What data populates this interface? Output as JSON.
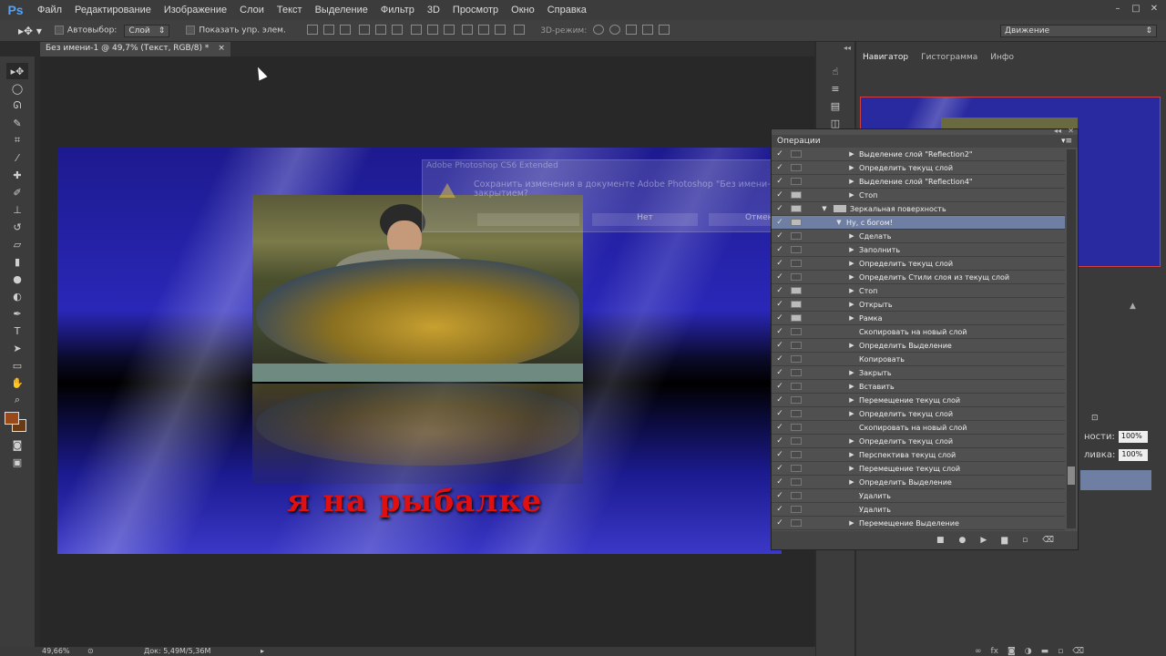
{
  "app": {
    "logo": "Ps"
  },
  "menu": [
    "Файл",
    "Редактирование",
    "Изображение",
    "Слои",
    "Текст",
    "Выделение",
    "Фильтр",
    "3D",
    "Просмотр",
    "Окно",
    "Справка"
  ],
  "options": {
    "autoselect_label": "Автовыбор:",
    "autoselect_value": "Слой",
    "show_controls_label": "Показать упр. элем.",
    "mode3d_label": "3D-режим:",
    "workspace_value": "Движение"
  },
  "document": {
    "tab_title": "Без имени-1 @ 49,7% (Текст, RGB/8) *",
    "close_glyph": "×",
    "artwork_text": "я на рыбалке"
  },
  "dialog": {
    "title": "Adobe Photoshop CS6 Extended",
    "message": "Сохранить изменения в документе Adobe Photoshop \"Без имени-1\" перед закрытием?",
    "no_button": "Нет",
    "cancel_button": "Отмена"
  },
  "status": {
    "zoom": "49,66%",
    "doc_size": "Док: 5,49M/5,36M"
  },
  "panels": {
    "navigator_tab": "Навигатор",
    "histogram_tab": "Гистограмма",
    "info_tab": "Инфо",
    "actions_title": "Операции",
    "opacity_label": "ности:",
    "opacity_value": "100%",
    "fill_label": "ливка:",
    "fill_value": "100%"
  },
  "actions": [
    {
      "text": "Выделение слой \"Reflection2\"",
      "checked": true,
      "dialog": false,
      "expander": "right",
      "indent": 0
    },
    {
      "text": "Определить текущ слой",
      "checked": true,
      "dialog": false,
      "expander": "right",
      "indent": 0
    },
    {
      "text": "Выделение слой \"Reflection4\"",
      "checked": true,
      "dialog": false,
      "expander": "right",
      "indent": 0
    },
    {
      "text": "Стоп",
      "checked": true,
      "dialog": true,
      "expander": "right",
      "indent": 0
    },
    {
      "text": "Зеркальная поверхность",
      "checked": true,
      "dialog": true,
      "expander": "down",
      "indent": -2,
      "set": true
    },
    {
      "text": "Ну, с богом!",
      "checked": true,
      "dialog": true,
      "expander": "down",
      "indent": -1,
      "selected": true
    },
    {
      "text": "Сделать",
      "checked": true,
      "dialog": false,
      "expander": "right",
      "indent": 0
    },
    {
      "text": "Заполнить",
      "checked": true,
      "dialog": false,
      "expander": "right",
      "indent": 0
    },
    {
      "text": "Определить текущ слой",
      "checked": true,
      "dialog": false,
      "expander": "right",
      "indent": 0
    },
    {
      "text": "Определить Стили слоя из текущ слой",
      "checked": true,
      "dialog": false,
      "expander": "right",
      "indent": 0
    },
    {
      "text": "Стоп",
      "checked": true,
      "dialog": true,
      "expander": "right",
      "indent": 0
    },
    {
      "text": "Открыть",
      "checked": true,
      "dialog": true,
      "expander": "right",
      "indent": 0
    },
    {
      "text": "Рамка",
      "checked": true,
      "dialog": true,
      "expander": "right",
      "indent": 0
    },
    {
      "text": "Скопировать на новый слой",
      "checked": true,
      "dialog": false,
      "expander": "none",
      "indent": 0
    },
    {
      "text": "Определить Выделение",
      "checked": true,
      "dialog": false,
      "expander": "right",
      "indent": 0
    },
    {
      "text": "Копировать",
      "checked": true,
      "dialog": false,
      "expander": "none",
      "indent": 0
    },
    {
      "text": "Закрыть",
      "checked": true,
      "dialog": false,
      "expander": "right",
      "indent": 0
    },
    {
      "text": "Вставить",
      "checked": true,
      "dialog": false,
      "expander": "right",
      "indent": 0
    },
    {
      "text": "Перемещение текущ слой",
      "checked": true,
      "dialog": false,
      "expander": "right",
      "indent": 0
    },
    {
      "text": "Определить текущ слой",
      "checked": true,
      "dialog": false,
      "expander": "right",
      "indent": 0
    },
    {
      "text": "Скопировать на новый слой",
      "checked": true,
      "dialog": false,
      "expander": "none",
      "indent": 0
    },
    {
      "text": "Определить текущ слой",
      "checked": true,
      "dialog": false,
      "expander": "right",
      "indent": 0
    },
    {
      "text": "Перспектива текущ слой",
      "checked": true,
      "dialog": false,
      "expander": "right",
      "indent": 0
    },
    {
      "text": "Перемещение текущ слой",
      "checked": true,
      "dialog": false,
      "expander": "right",
      "indent": 0
    },
    {
      "text": "Определить Выделение",
      "checked": true,
      "dialog": false,
      "expander": "right",
      "indent": 0
    },
    {
      "text": "Удалить",
      "checked": true,
      "dialog": false,
      "expander": "none",
      "indent": 0
    },
    {
      "text": "Удалить",
      "checked": true,
      "dialog": false,
      "expander": "none",
      "indent": 0
    },
    {
      "text": "Перемещение Выделение",
      "checked": true,
      "dialog": false,
      "expander": "right",
      "indent": 0
    }
  ],
  "colors": {
    "foreground": "#9a4a1a",
    "background": "#6a3a10",
    "selected_row": "#6f7fa3"
  }
}
